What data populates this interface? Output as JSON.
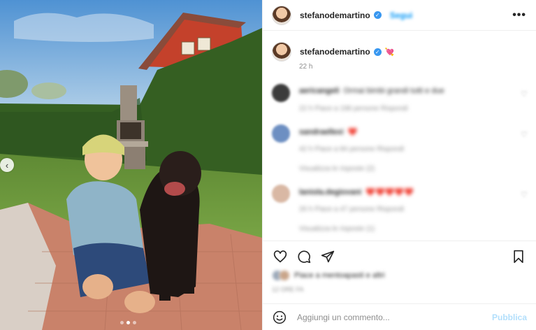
{
  "post": {
    "username": "stefanodemartino",
    "follow_label": "Segui",
    "more_label": "•••",
    "caption_username": "stefanodemartino",
    "caption_emoji": "💘",
    "time_ago": "22 h"
  },
  "photo": {
    "prev_label": "‹",
    "dots": 3,
    "active_dot": 1
  },
  "comments": [
    {
      "user": "aericangeli",
      "text": "Ormai bimbi grandi tutti e due",
      "meta": "22 h   Piace a 198 persone   Rispondi",
      "avatar_color": "#3c3c3c"
    },
    {
      "user": "sandraellexi",
      "text": "❤️",
      "meta": "42 h   Piace a 84 persone   Rispondi",
      "avatar_color": "#6d8fc2",
      "replies": "Visualizza le risposte (2)"
    },
    {
      "user": "laniola.degiovani",
      "text": "❤️❤️❤️❤️❤️",
      "meta": "26 h   Piace a 47 persone   Rispondi",
      "avatar_color": "#d9b8a4",
      "replies": "Visualizza le risposte (1)"
    }
  ],
  "likes": {
    "text": "Piace a mentoapasti e altri"
  },
  "date": "12 ORE FA",
  "add_comment": {
    "placeholder": "Aggiungi un commento...",
    "publish_label": "Pubblica"
  },
  "colors": {
    "accent": "#0095f6",
    "publish_disabled": "#b2dffc",
    "verified": "#3897f0"
  }
}
